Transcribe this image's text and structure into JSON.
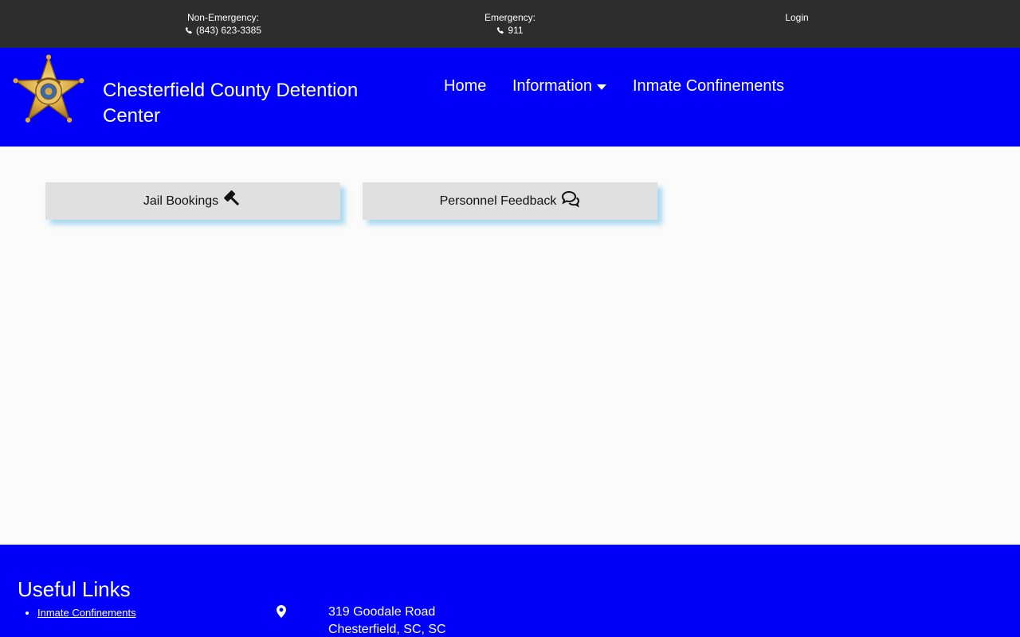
{
  "topbar": {
    "non_emergency_label": "Non-Emergency:",
    "non_emergency_phone": "(843) 623-3385",
    "emergency_label": "Emergency:",
    "emergency_phone": "911",
    "login": "Login",
    "background": "#2d2d2d"
  },
  "header": {
    "site_title": "Chesterfield County Detention Center",
    "logo_icon": "sheriff-star-badge",
    "background": "#0000fa"
  },
  "nav": {
    "home": "Home",
    "information": "Information",
    "inmate_confinements": "Inmate Confinements"
  },
  "main": {
    "buttons": [
      {
        "label": "Jail Bookings",
        "icon": "gavel-icon"
      },
      {
        "label": "Personnel Feedback",
        "icon": "comments-icon"
      }
    ]
  },
  "footer": {
    "heading": "Useful Links",
    "links": [
      "Inmate Confinements"
    ],
    "address_line1": "319 Goodale Road",
    "address_line2": "Chesterfield, SC, SC",
    "icon": "map-marker-icon"
  }
}
